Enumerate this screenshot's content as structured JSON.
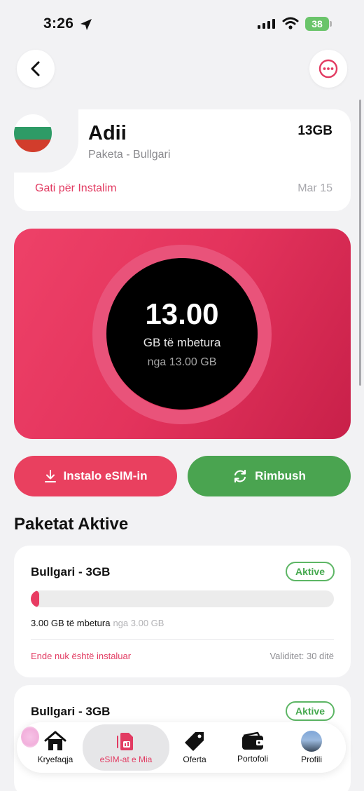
{
  "status_bar": {
    "time": "3:26",
    "battery": "38"
  },
  "plan": {
    "name": "Adii",
    "size": "13GB",
    "subtitle": "Paketa - Bullgari",
    "status": "Gati për Instalim",
    "date": "Mar 15"
  },
  "gauge": {
    "value": "13.00",
    "label": "GB të mbetura",
    "of_label": "nga 13.00 GB"
  },
  "actions": {
    "install_label": "Instalo eSIM-in",
    "refill_label": "Rimbush"
  },
  "section_title": "Paketat Aktive",
  "packages": [
    {
      "title": "Bullgari - 3GB",
      "badge": "Aktive",
      "remaining": "3.00 GB të mbetura",
      "of_label": "nga 3.00 GB",
      "install_status": "Ende nuk është instaluar",
      "validity": "Validitet: 30 ditë"
    },
    {
      "title": "Bullgari - 3GB",
      "badge": "Aktive"
    }
  ],
  "nav": {
    "home": "Kryefaqja",
    "esim": "eSIM-at e Mia",
    "offers": "Oferta",
    "wallet": "Portofoli",
    "profile": "Profili"
  },
  "icons": {
    "back": "chevron-left-icon",
    "more": "more-horizontal-circle-icon",
    "install": "download-icon",
    "refill": "refresh-icon",
    "home": "home-icon",
    "esim": "sim-card-icon",
    "offers": "tag-icon",
    "wallet": "wallet-icon"
  },
  "colors": {
    "accent": "#e9405f",
    "success": "#4aa450",
    "gauge_bg": "#e3335c"
  },
  "flag_colors": [
    "#ffffff",
    "#2e9b66",
    "#d23d2c"
  ]
}
